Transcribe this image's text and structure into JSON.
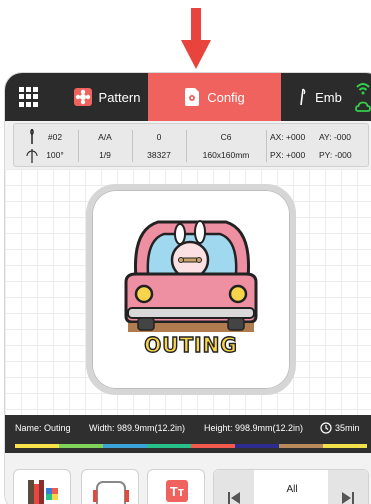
{
  "tabs": {
    "pattern": "Pattern",
    "config": "Config",
    "emb": "Emb",
    "active": "Config"
  },
  "info": {
    "needle": "#02",
    "angle": "100°",
    "frame_a": "A/A",
    "frame_b": "1/9",
    "count_a": "0",
    "count_b": "38327",
    "hoop_code": "C6",
    "hoop_size": "160x160mm",
    "ax": "AX: +000",
    "ay": "AY: -000",
    "px": "PX: +000",
    "py": "PY: -000"
  },
  "design": {
    "label": "OUTING"
  },
  "strip": {
    "name": "Name: Outing",
    "width": "Width: 989.9mm(12.2in)",
    "height": "Height: 998.9mm(12.2in)",
    "time": "35min"
  },
  "color_stops": [
    "#f7e24a",
    "#7fd35a",
    "#3aa3d9",
    "#27c08a",
    "#f25a4e",
    "#2d2d8f",
    "#b98a5a",
    "#f2e04a"
  ],
  "pager": {
    "label": "All"
  },
  "colors": {
    "accent": "#f0625d",
    "tabbar": "#2b2b2b",
    "wifi": "#35d04a"
  }
}
